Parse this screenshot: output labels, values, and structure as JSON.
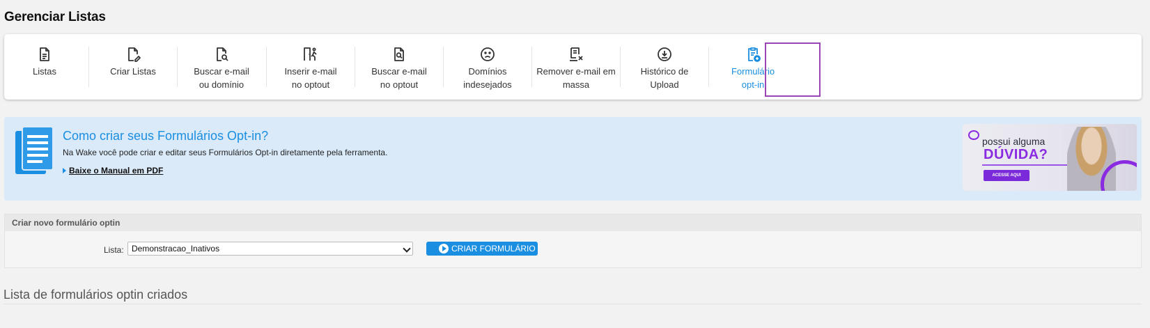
{
  "page_title": "Gerenciar Listas",
  "toolbar": {
    "items": [
      {
        "line1": "Listas",
        "line2": "",
        "icon": "file-lines-icon"
      },
      {
        "line1": "Criar Listas",
        "line2": "",
        "icon": "file-pen-icon"
      },
      {
        "line1": "Buscar e-mail",
        "line2": "ou domínio",
        "icon": "file-search-icon"
      },
      {
        "line1": "Inserir e-mail",
        "line2": "no optout",
        "icon": "door-walk-icon"
      },
      {
        "line1": "Buscar e-mail",
        "line2": "no optout",
        "icon": "file-magnify-icon"
      },
      {
        "line1": "Domínios",
        "line2": "indesejados",
        "icon": "frown-face-icon"
      },
      {
        "line1": "Remover e-mail em",
        "line2": "massa",
        "icon": "receipt-x-icon"
      },
      {
        "line1": "Histórico de",
        "line2": "Upload",
        "icon": "download-circle-icon"
      },
      {
        "line1": "Formulário",
        "line2": "opt-in",
        "icon": "clipboard-plus-icon"
      }
    ],
    "active_color": "#1a8ee1",
    "highlight_color": "#9b44b6"
  },
  "info": {
    "title": "Como criar seus Formulários Opt-in?",
    "description": "Na Wake você pode criar e editar seus Formulários Opt-in diretamente pela ferramenta.",
    "link": "Baixe o Manual em PDF"
  },
  "banner": {
    "line1": "possui alguma",
    "line2": "DÚVIDA?",
    "button": "ACESSE AQUI"
  },
  "form": {
    "header": "Criar novo formulário optin",
    "label": "Lista:",
    "selected_value": "Demonstracao_Inativos",
    "button": "CRIAR FORMULÁRIO"
  },
  "list_section": {
    "title": "Lista de formulários optin criados"
  }
}
